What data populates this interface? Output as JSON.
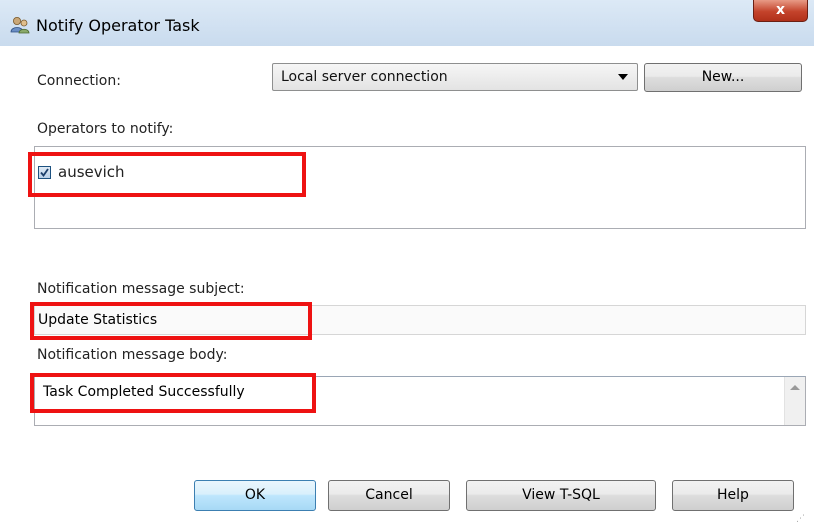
{
  "window": {
    "title": "Notify Operator Task",
    "close_label": "x"
  },
  "connection": {
    "label": "Connection:",
    "selected": "Local server connection",
    "new_button": "New..."
  },
  "operators": {
    "label": "Operators to notify:",
    "items": [
      {
        "name": "ausevich",
        "checked": true
      }
    ]
  },
  "subject": {
    "label": "Notification message subject:",
    "value": "Update Statistics"
  },
  "body": {
    "label": "Notification message body:",
    "value": "Task Completed Successfully"
  },
  "buttons": {
    "ok": "OK",
    "cancel": "Cancel",
    "view_tsql": "View T-SQL",
    "help": "Help"
  },
  "colors": {
    "highlight": "#ee1212",
    "checkbox": "#1c5180"
  },
  "icons": {
    "title": "users-icon",
    "close": "close-icon",
    "dropdown": "chevron-down-icon",
    "checkbox": "checkmark-icon",
    "scroll": "scroll-up-arrow-icon"
  }
}
